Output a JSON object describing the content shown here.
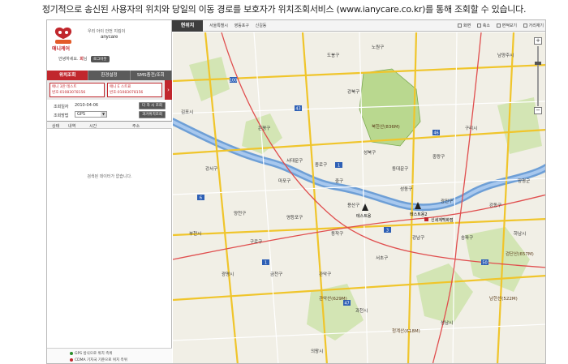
{
  "caption": "정기적으로 송신된 사용자의 위치와 당일의 이동 경로를 보호자가 위치조회서비스 (www.ianycare.co.kr)를 통해 조회할 수 있습니다.",
  "brand": {
    "logo_text": "애니케어",
    "slogan": "우리 아이 안전 지킴이",
    "name": "anycare"
  },
  "greeting": {
    "prefix": "안녕하세요.",
    "user": "희",
    "suffix": "님",
    "logout_label": "로그아웃"
  },
  "tabs": [
    {
      "label": "위치조회",
      "active": true
    },
    {
      "label": "환경설정",
      "active": false
    },
    {
      "label": "SMS충전/조회",
      "active": false
    }
  ],
  "cards": [
    {
      "line1": "애니  3만 테스트",
      "line2": "번호:01083078156"
    },
    {
      "line1": "애니  E 스트료",
      "line2": "번호:01083078156"
    }
  ],
  "query": {
    "date_label": "조회일자",
    "date_value": "2010-04-06",
    "date_button": "다 자 시 조회",
    "method_label": "조회방법",
    "method_value": "GPS",
    "method_button": "과거위치조회"
  },
  "list": {
    "headers": [
      "상태",
      "내역",
      "시간",
      "주소"
    ],
    "empty_message": "검색된 데이터가 없습니다."
  },
  "legend": [
    {
      "label": "GPS 방식으로 위치 측위",
      "color": "#2a8f2a"
    },
    {
      "label": "CDMA 기지국 기준으로 위치 측위",
      "color": "#c1272d"
    }
  ],
  "map_header": {
    "current_tab": "현위치",
    "breadcrumbs": [
      "서울특별시",
      "영등포구",
      "신길동"
    ],
    "tools": [
      "화면",
      "축소",
      "면적보기",
      "거리재기"
    ]
  },
  "map_labels": {
    "places": [
      "노원구",
      "도봉구",
      "강북구",
      "성북구",
      "은평구",
      "종로구",
      "중구",
      "용산구",
      "마포구",
      "서대문구",
      "동대문구",
      "중랑구",
      "광진구",
      "성동구",
      "강남구",
      "서초구",
      "송파구",
      "강동구",
      "동작구",
      "관악구",
      "영등포구",
      "구로구",
      "금천구",
      "양천구",
      "강서구",
      "하남시",
      "과천시",
      "광명시",
      "김포시",
      "부천시",
      "남양주시",
      "구리시",
      "양평군",
      "성남시",
      "의왕시"
    ],
    "mountains": [
      "북한산(836M)",
      "청계산(618M)",
      "관악산(629M)",
      "남한산(522M)",
      "검단산(657M)"
    ],
    "markers": [
      "테스트용",
      "테스트용2",
      "신세계백화점"
    ]
  }
}
